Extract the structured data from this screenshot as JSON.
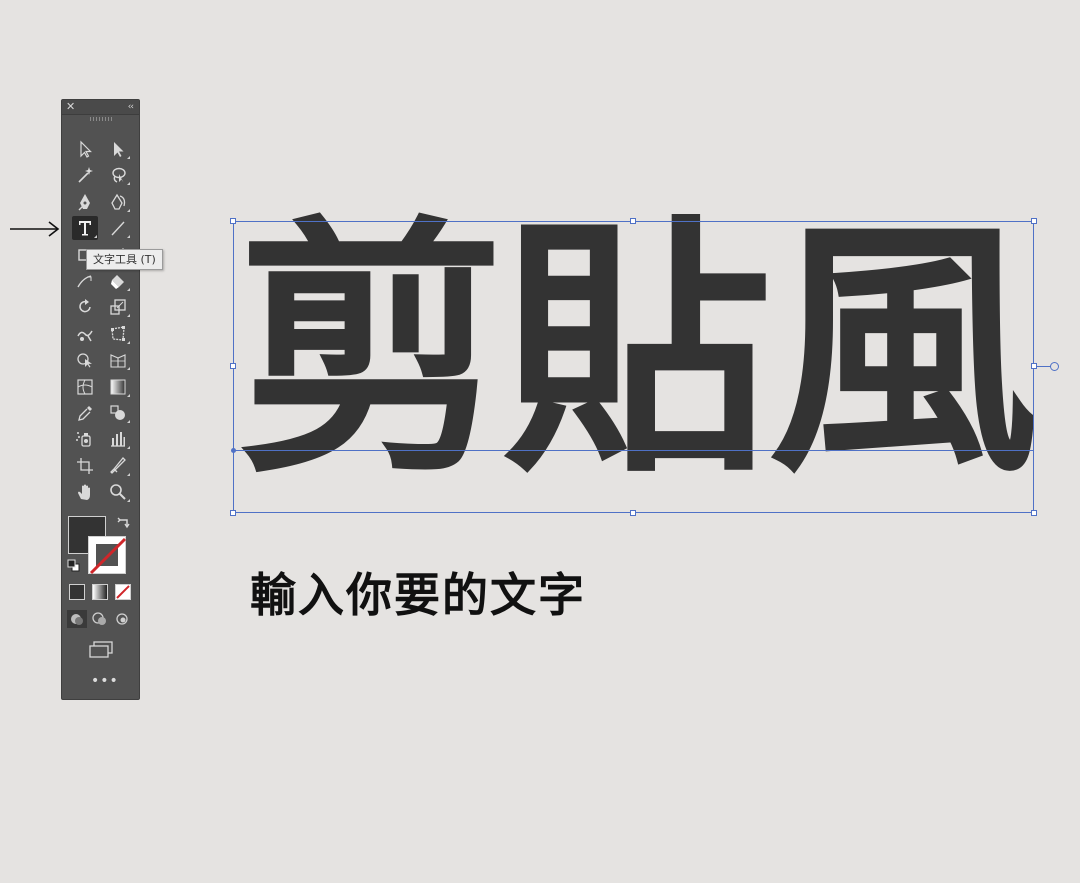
{
  "toolbar": {
    "close_glyph": "✕",
    "collapse_glyph": "‹‹",
    "more_glyph": "•••",
    "tools": [
      {
        "name": "selection-tool",
        "icon": "arrow-outline-icon"
      },
      {
        "name": "direct-selection-tool",
        "icon": "arrow-solid-icon"
      },
      {
        "name": "magic-wand-tool",
        "icon": "magic-wand-icon"
      },
      {
        "name": "lasso-tool",
        "icon": "lasso-icon"
      },
      {
        "name": "pen-tool",
        "icon": "pen-icon"
      },
      {
        "name": "curvature-tool",
        "icon": "curvature-icon"
      },
      {
        "name": "type-tool",
        "icon": "type-icon",
        "active": true
      },
      {
        "name": "line-segment-tool",
        "icon": "line-icon"
      },
      {
        "name": "rectangle-tool",
        "icon": "rectangle-icon"
      },
      {
        "name": "paintbrush-tool",
        "icon": "paintbrush-icon"
      },
      {
        "name": "shaper-tool",
        "icon": "shaper-icon"
      },
      {
        "name": "eraser-tool",
        "icon": "eraser-icon"
      },
      {
        "name": "rotate-tool",
        "icon": "rotate-icon"
      },
      {
        "name": "scale-tool",
        "icon": "scale-icon"
      },
      {
        "name": "warp-tool",
        "icon": "warp-icon"
      },
      {
        "name": "free-transform-tool",
        "icon": "free-transform-icon"
      },
      {
        "name": "shape-builder-tool",
        "icon": "shape-builder-icon"
      },
      {
        "name": "perspective-grid-tool",
        "icon": "perspective-grid-icon"
      },
      {
        "name": "mesh-tool",
        "icon": "mesh-icon"
      },
      {
        "name": "gradient-tool",
        "icon": "gradient-icon"
      },
      {
        "name": "eyedropper-tool",
        "icon": "eyedropper-icon"
      },
      {
        "name": "blend-tool",
        "icon": "blend-icon"
      },
      {
        "name": "symbol-sprayer-tool",
        "icon": "symbol-sprayer-icon"
      },
      {
        "name": "column-graph-tool",
        "icon": "column-graph-icon"
      },
      {
        "name": "artboard-tool",
        "icon": "artboard-icon"
      },
      {
        "name": "slice-tool",
        "icon": "slice-icon"
      },
      {
        "name": "hand-tool",
        "icon": "hand-icon"
      },
      {
        "name": "zoom-tool",
        "icon": "zoom-icon"
      }
    ],
    "fill_color": "#333333",
    "stroke_color": "none"
  },
  "tooltip": {
    "text": "文字工具 (T)"
  },
  "canvas": {
    "headline": "剪貼風",
    "caption": "輸入你要的文字",
    "text_color": "#333333",
    "selection_color": "#4f71c6"
  }
}
